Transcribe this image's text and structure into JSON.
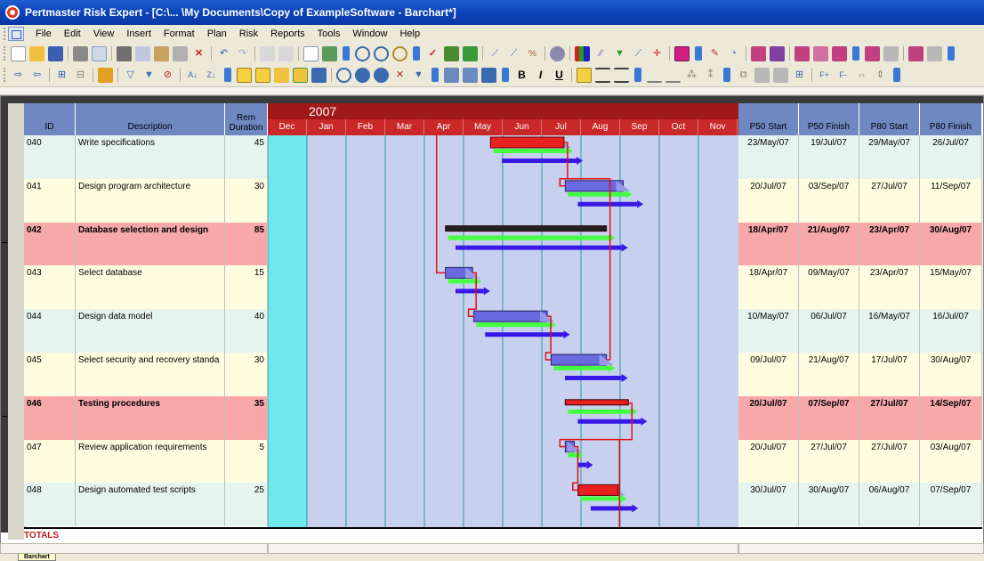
{
  "window": {
    "title": "Pertmaster Risk Expert - [C:\\... \\My Documents\\Copy of ExampleSoftware - Barchart*]"
  },
  "menu": [
    "File",
    "Edit",
    "View",
    "Insert",
    "Format",
    "Plan",
    "Risk",
    "Reports",
    "Tools",
    "Window",
    "Help"
  ],
  "toolbar_text_buttons": {
    "bold": "B",
    "italic": "I",
    "underline": "U"
  },
  "columns": {
    "id": "ID",
    "description": "Description",
    "rem_duration": "Rem Duration",
    "p50_start": "P50 Start",
    "p50_finish": "P50 Finish",
    "p80_start": "P80 Start",
    "p80_finish": "P80 Finish"
  },
  "gantt": {
    "year": "2007",
    "months": [
      "Dec",
      "Jan",
      "Feb",
      "Mar",
      "Apr",
      "May",
      "Jun",
      "Jul",
      "Aug",
      "Sep",
      "Oct",
      "Nov"
    ]
  },
  "tasks": [
    {
      "id": "040",
      "description": "Write specifications",
      "rem_duration": "45",
      "p50_start": "23/May/07",
      "p50_finish": "19/Jul/07",
      "p80_start": "29/May/07",
      "p80_finish": "26/Jul/07",
      "summary": false
    },
    {
      "id": "041",
      "description": "Design program architecture",
      "rem_duration": "30",
      "p50_start": "20/Jul/07",
      "p50_finish": "03/Sep/07",
      "p80_start": "27/Jul/07",
      "p80_finish": "11/Sep/07",
      "summary": false
    },
    {
      "id": "042",
      "description": "Database selection and design",
      "rem_duration": "85",
      "p50_start": "18/Apr/07",
      "p50_finish": "21/Aug/07",
      "p80_start": "23/Apr/07",
      "p80_finish": "30/Aug/07",
      "summary": true
    },
    {
      "id": "043",
      "description": "Select database",
      "rem_duration": "15",
      "p50_start": "18/Apr/07",
      "p50_finish": "09/May/07",
      "p80_start": "23/Apr/07",
      "p80_finish": "15/May/07",
      "summary": false
    },
    {
      "id": "044",
      "description": "Design data model",
      "rem_duration": "40",
      "p50_start": "10/May/07",
      "p50_finish": "06/Jul/07",
      "p80_start": "16/May/07",
      "p80_finish": "16/Jul/07",
      "summary": false
    },
    {
      "id": "045",
      "description": "Select security and recovery standa",
      "rem_duration": "30",
      "p50_start": "09/Jul/07",
      "p50_finish": "21/Aug/07",
      "p80_start": "17/Jul/07",
      "p80_finish": "30/Aug/07",
      "summary": false
    },
    {
      "id": "046",
      "description": "Testing procedures",
      "rem_duration": "35",
      "p50_start": "20/Jul/07",
      "p50_finish": "07/Sep/07",
      "p80_start": "27/Jul/07",
      "p80_finish": "14/Sep/07",
      "summary": true
    },
    {
      "id": "047",
      "description": "Review application requirements",
      "rem_duration": "5",
      "p50_start": "20/Jul/07",
      "p50_finish": "27/Jul/07",
      "p80_start": "27/Jul/07",
      "p80_finish": "03/Aug/07",
      "summary": false
    },
    {
      "id": "048",
      "description": "Design automated test scripts",
      "rem_duration": "25",
      "p50_start": "30/Jul/07",
      "p50_finish": "30/Aug/07",
      "p80_start": "06/Aug/07",
      "p80_finish": "07/Sep/07",
      "summary": false
    }
  ],
  "totals_label": "TOTALS",
  "sheet_tab": "Barchart",
  "colors": {
    "row_even": "#e6f4f0",
    "row_odd": "#fffde0",
    "row_summary": "#f8a8a8",
    "gantt_bg": "#c8d0f0",
    "bar_planned": "#e82020",
    "bar_p50": "#44ff44",
    "bar_p80": "#3818e8",
    "bar_current": "#6a6ae0",
    "link": "#e01010"
  }
}
